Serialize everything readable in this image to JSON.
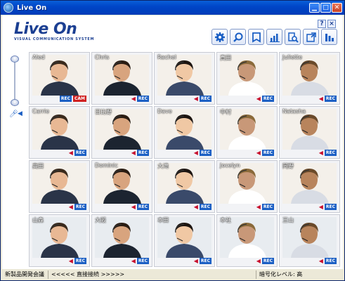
{
  "window": {
    "title": "Live On"
  },
  "logo": {
    "text": "Live On",
    "subtitle": "VISUAL COMMUNICATION SYSTEM"
  },
  "help": {
    "question": "?",
    "close": "×"
  },
  "toolbar": [
    {
      "icon": "gear-icon"
    },
    {
      "icon": "search-icon"
    },
    {
      "icon": "bookmark-icon"
    },
    {
      "icon": "bar-chart-icon"
    },
    {
      "icon": "magnify-document-icon"
    },
    {
      "icon": "document-arrow-icon"
    },
    {
      "icon": "layout-icon"
    }
  ],
  "tiles": [
    {
      "name": "Aled",
      "rec": "REC",
      "cam": "CAM",
      "speaker": false
    },
    {
      "name": "Chris",
      "rec": "REC",
      "speaker": true
    },
    {
      "name": "Rachel",
      "rec": "REC",
      "speaker": true
    },
    {
      "name": "真田",
      "rec": "REC",
      "speaker": true
    },
    {
      "name": "Juliette",
      "rec": "REC",
      "speaker": true
    },
    {
      "name": "Carrie",
      "rec": "REC",
      "speaker": true
    },
    {
      "name": "日比野",
      "rec": "REC",
      "speaker": true
    },
    {
      "name": "Dave",
      "rec": "REC",
      "speaker": true
    },
    {
      "name": "中村",
      "rec": "REC",
      "speaker": true
    },
    {
      "name": "Natasha",
      "rec": "REC",
      "speaker": true
    },
    {
      "name": "高田",
      "rec": "REC",
      "speaker": true
    },
    {
      "name": "Dominic",
      "rec": "REC",
      "speaker": true
    },
    {
      "name": "大滝",
      "rec": "REC",
      "speaker": true
    },
    {
      "name": "Jocelyn",
      "rec": "REC",
      "speaker": true
    },
    {
      "name": "岡野",
      "rec": "REC",
      "speaker": true
    },
    {
      "name": "山森",
      "rec": "REC",
      "speaker": true
    },
    {
      "name": "大阪",
      "rec": "REC",
      "speaker": true
    },
    {
      "name": "本田",
      "rec": "REC",
      "speaker": true
    },
    {
      "name": "本社",
      "rec": "REC",
      "speaker": true
    },
    {
      "name": "王山",
      "rec": "REC",
      "speaker": true
    }
  ],
  "status": {
    "room": "新製品開発会議",
    "connection": "<<<<< 直接接続 >>>>>",
    "encryption": "暗号化レベル: 高"
  },
  "colors": {
    "accent": "#1b5fc4",
    "titlebar": "#0046c8",
    "rec": "#1b5fc4",
    "cam": "#d02020"
  }
}
